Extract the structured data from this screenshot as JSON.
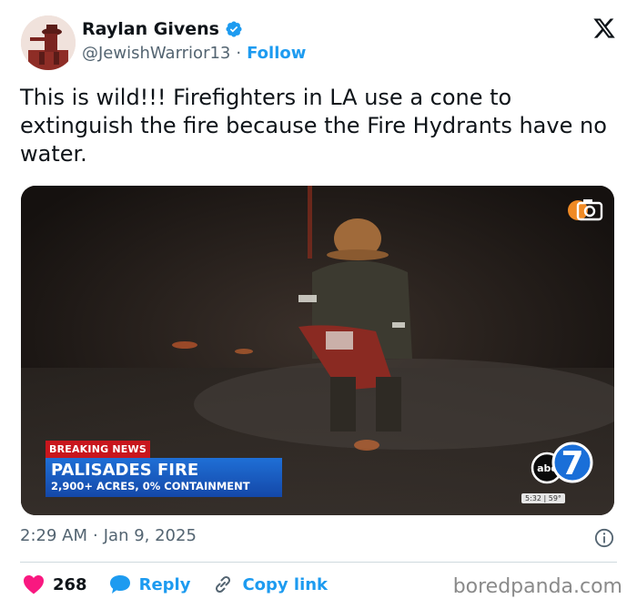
{
  "author": {
    "display_name": "Raylan Givens",
    "handle": "@JewishWarrior13",
    "follow_label": "Follow",
    "verified_icon": "verified-badge-icon",
    "verified_color": "#1d9bf0"
  },
  "tweet": {
    "text": "This is wild!!! Firefighters in LA use a cone to extinguish the fire because the Fire Hydrants have no water."
  },
  "media": {
    "breaking_label": "BREAKING NEWS",
    "headline": "PALISADES FIRE",
    "subheadline": "2,900+ ACRES, 0% CONTAINMENT",
    "channel_logo_text": "abc",
    "channel_number": "7",
    "time_bug": "5:32 | 59°"
  },
  "meta": {
    "time": "2:29 AM",
    "date": "Jan 9, 2025"
  },
  "actions": {
    "like_count": "268",
    "reply_label": "Reply",
    "copy_label": "Copy link"
  },
  "watermark": "boredpanda.com",
  "colors": {
    "accent": "#1d9bf0",
    "like": "#f91880",
    "text": "#0f1419",
    "muted": "#536471"
  }
}
